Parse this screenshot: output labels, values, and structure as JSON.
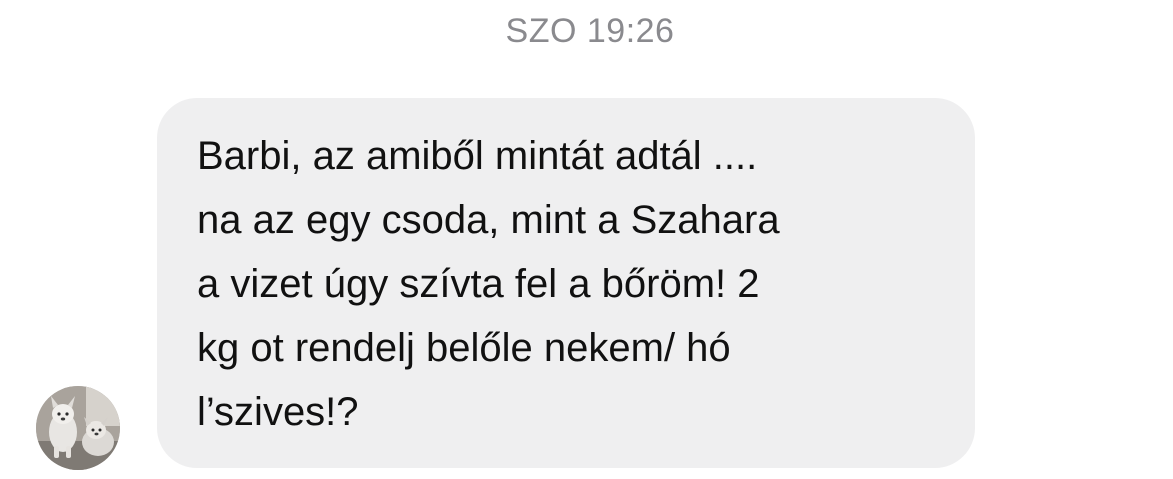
{
  "conversation": {
    "timestamp": "SZO 19:26",
    "message": {
      "text": "Barbi, az amiből mintát adtál ....\nna az egy csoda, mint a Szahara\na vizet úgy szívta fel a bőröm! 2\nkg ot rendelj belőle nekem/ hó\nl’szives!?",
      "bubble_color": "#efeff0",
      "sender_avatar_icon": "dog-avatar-icon"
    }
  }
}
